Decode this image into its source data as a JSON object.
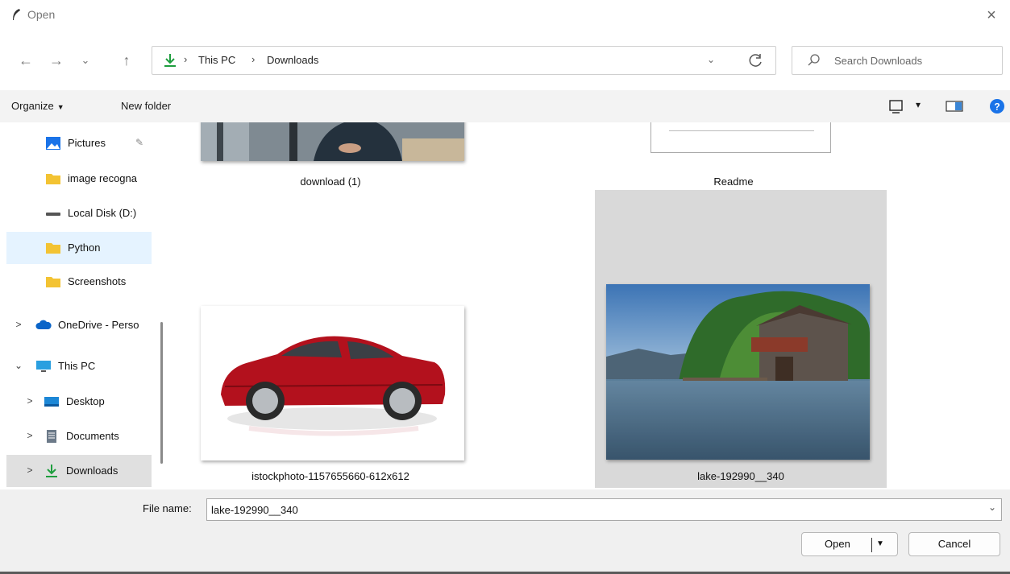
{
  "window": {
    "title": "Open",
    "close_glyph": "×"
  },
  "nav": {
    "back": "←",
    "forward": "→",
    "recent": "⌄",
    "up": "↑",
    "breadcrumb": [
      "This PC",
      "Downloads"
    ],
    "separator": "›",
    "dropdown": "⌄",
    "search_placeholder": "Search Downloads"
  },
  "toolbar": {
    "organize": "Organize",
    "organize_caret": "▼",
    "new_folder": "New folder",
    "view_caret": "▾"
  },
  "sidebar": {
    "items": [
      {
        "label": "Pictures",
        "icon": "pictures-icon",
        "pinned": true
      },
      {
        "label": "image recogna",
        "icon": "folder-icon"
      },
      {
        "label": "Local Disk (D:)",
        "icon": "drive-icon"
      },
      {
        "label": "Python",
        "icon": "folder-icon",
        "selected": true
      },
      {
        "label": "Screenshots",
        "icon": "folder-icon"
      },
      {
        "label": "OneDrive - Perso",
        "icon": "cloud-icon",
        "expander": ">"
      },
      {
        "label": "This PC",
        "icon": "computer-icon",
        "expander": "⌄"
      },
      {
        "label": "Desktop",
        "icon": "desktop-icon",
        "expander": ">"
      },
      {
        "label": "Documents",
        "icon": "documents-icon",
        "expander": ">"
      },
      {
        "label": "Downloads",
        "icon": "download-icon",
        "expander": ">",
        "current": true
      }
    ],
    "pin_glyph": "📌"
  },
  "files": [
    {
      "name": "download (1)",
      "thumbnail": "person-at-desk-photo"
    },
    {
      "name": "Readme",
      "thumbnail": "document-page"
    },
    {
      "name": "istockphoto-1157655660-612x612",
      "thumbnail": "red-car-photo"
    },
    {
      "name": "lake-192990__340",
      "thumbnail": "lake-boathouse-photo",
      "selected": true
    }
  ],
  "footer": {
    "file_name_label": "File name:",
    "file_name_value": "lake-192990__340",
    "file_name_caret": "⌄",
    "open_label": "Open",
    "open_arrow": "▼",
    "cancel_label": "Cancel"
  },
  "colors": {
    "accent": "#1e9e3e",
    "selected_bg": "#e5f3ff",
    "item_selected": "#d9d9d9",
    "folder": "#f3c333",
    "help": "#1a73e8"
  }
}
